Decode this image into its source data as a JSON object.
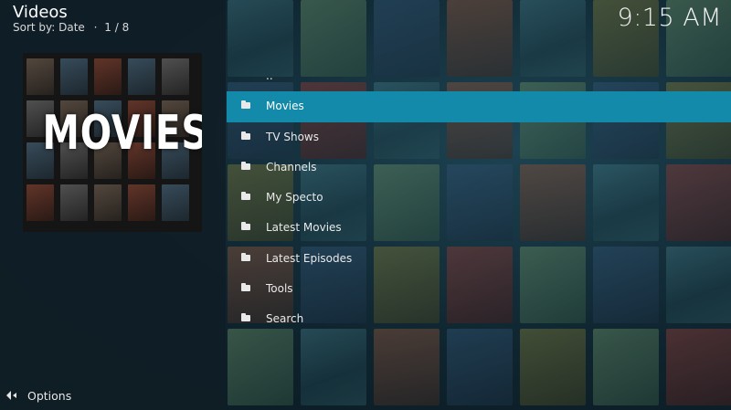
{
  "header": {
    "title": "Videos",
    "sort_label": "Sort by: Date",
    "separator": "·",
    "page_indicator": "1 / 8",
    "clock": "9:15 AM"
  },
  "thumbnail": {
    "label": "MOVIES"
  },
  "list": {
    "items": [
      {
        "label": "..",
        "icon": "none",
        "selected": false
      },
      {
        "label": "Movies",
        "icon": "folder-icon",
        "selected": true
      },
      {
        "label": "TV Shows",
        "icon": "folder-icon",
        "selected": false
      },
      {
        "label": "Channels",
        "icon": "folder-icon",
        "selected": false
      },
      {
        "label": "My Specto",
        "icon": "folder-icon",
        "selected": false
      },
      {
        "label": "Latest Movies",
        "icon": "folder-icon",
        "selected": false
      },
      {
        "label": "Latest Episodes",
        "icon": "folder-icon",
        "selected": false
      },
      {
        "label": "Tools",
        "icon": "folder-icon",
        "selected": false
      },
      {
        "label": "Search",
        "icon": "folder-icon",
        "selected": false
      }
    ]
  },
  "footer": {
    "options_label": "Options",
    "options_icon": "arrows-icon"
  },
  "colors": {
    "accent": "#138aa9",
    "panel": "#101e26",
    "text": "#e9e9e9"
  }
}
